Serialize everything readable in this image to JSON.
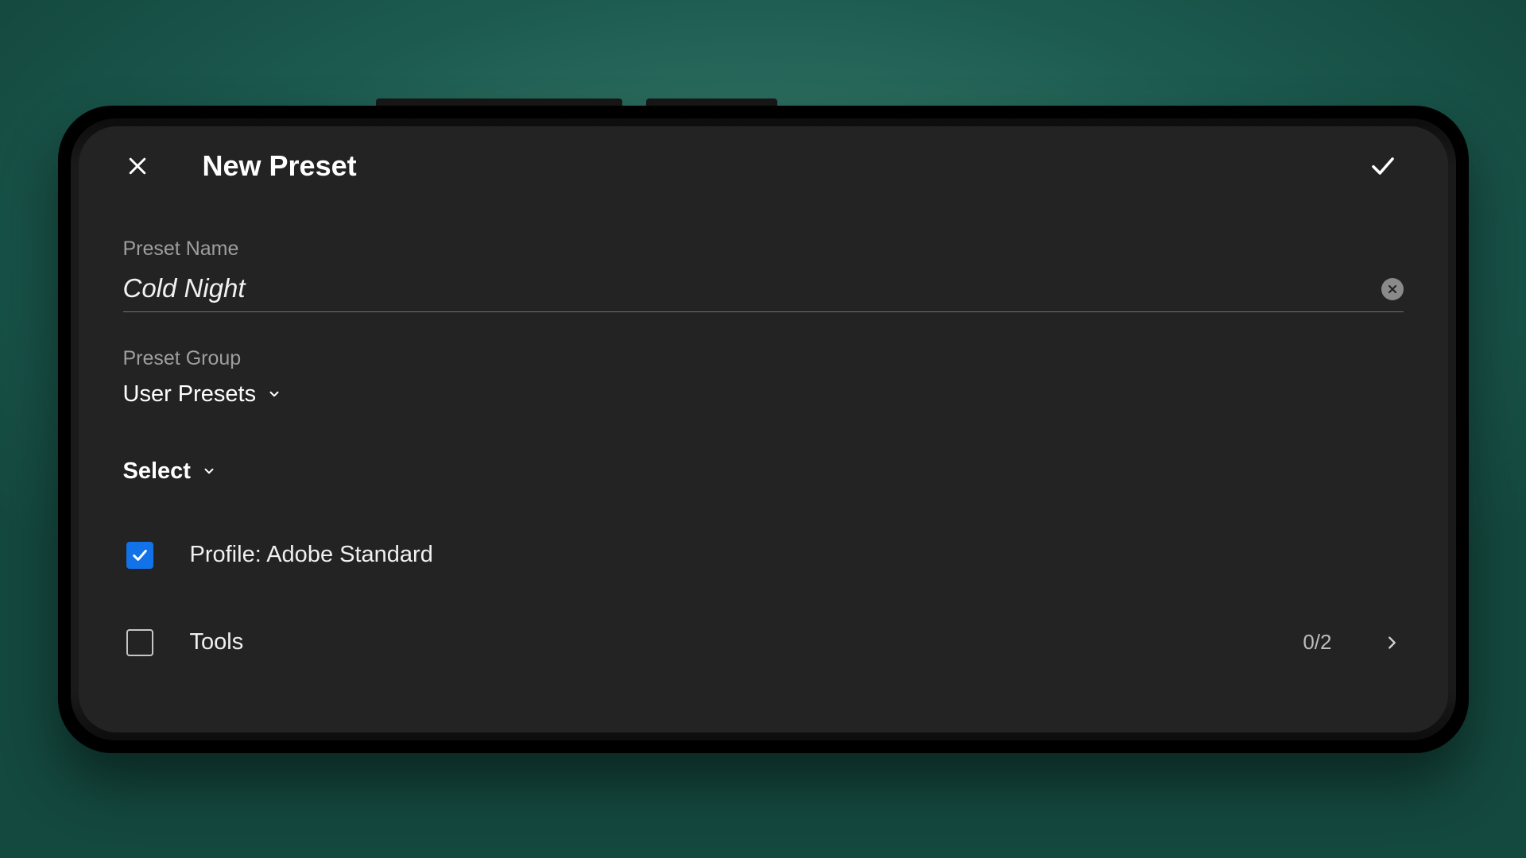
{
  "header": {
    "title": "New Preset"
  },
  "fields": {
    "name_label": "Preset Name",
    "name_value": "Cold Night",
    "group_label": "Preset Group",
    "group_value": "User Presets"
  },
  "select": {
    "label": "Select"
  },
  "options": [
    {
      "label": "Profile: Adobe Standard",
      "checked": true,
      "count": "",
      "expandable": false
    },
    {
      "label": "Tools",
      "checked": false,
      "count": "0/2",
      "expandable": true
    }
  ],
  "colors": {
    "accent": "#1272e8"
  }
}
